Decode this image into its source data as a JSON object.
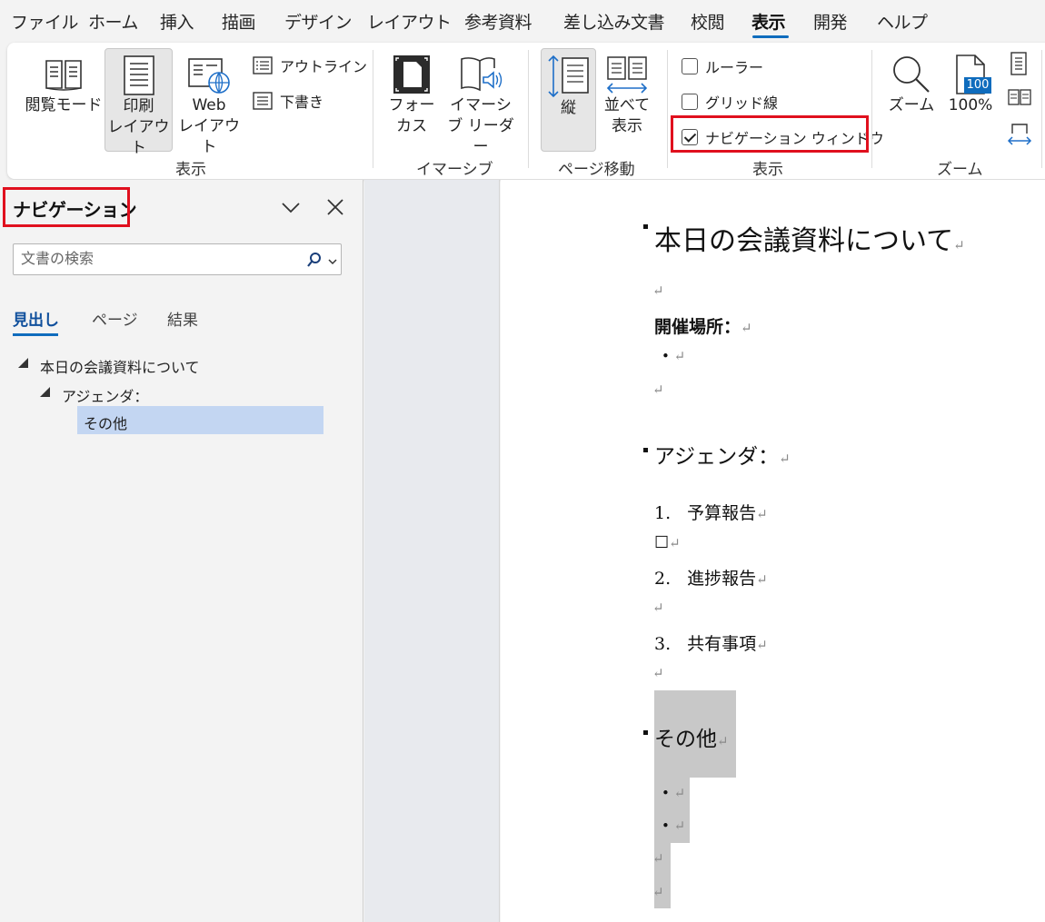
{
  "menubar": {
    "items": [
      {
        "label": "ファイル"
      },
      {
        "label": "ホーム"
      },
      {
        "label": "挿入"
      },
      {
        "label": "描画"
      },
      {
        "label": "デザイン"
      },
      {
        "label": "レイアウト"
      },
      {
        "label": "参考資料"
      },
      {
        "label": "差し込み文書"
      },
      {
        "label": "校閲"
      },
      {
        "label": "表示"
      },
      {
        "label": "開発"
      },
      {
        "label": "ヘルプ"
      }
    ]
  },
  "ribbon": {
    "views_group": {
      "label": "表示",
      "read_mode": "閲覧モード",
      "print_layout_1": "印刷",
      "print_layout_2": "レイアウト",
      "web_layout_1": "Web",
      "web_layout_2": "レイアウト",
      "outline": "アウトライン",
      "draft": "下書き"
    },
    "immersive_group": {
      "label": "イマーシブ",
      "focus_1": "フォー",
      "focus_2": "カス",
      "reader_1": "イマーシ",
      "reader_2": "ブ リーダー"
    },
    "page_move_group": {
      "label": "ページ移動",
      "vertical": "縦",
      "side_1": "並べて",
      "side_2": "表示"
    },
    "show_group": {
      "label": "表示",
      "ruler": "ルーラー",
      "gridlines": "グリッド線",
      "nav_pane": "ナビゲーション ウィンドウ",
      "ruler_checked": false,
      "gridlines_checked": false,
      "nav_pane_checked": true
    },
    "zoom_group": {
      "label": "ズーム",
      "zoom": "ズーム",
      "percent": "100%",
      "icon_badge": "100"
    }
  },
  "nav_pane": {
    "title": "ナビゲーション",
    "search_placeholder": "文書の検索",
    "tabs": [
      {
        "label": "見出し"
      },
      {
        "label": "ページ"
      },
      {
        "label": "結果"
      }
    ],
    "tree": [
      {
        "label": "本日の会議資料について"
      },
      {
        "label": "アジェンダ："
      },
      {
        "label": "その他"
      }
    ]
  },
  "document": {
    "heading1": "本日の会議資料について",
    "venue_label": "開催場所：",
    "agenda_heading": "アジェンダ：",
    "list": [
      {
        "num": "1.",
        "text": "予算報告"
      },
      {
        "num": "2.",
        "text": "進捗報告"
      },
      {
        "num": "3.",
        "text": "共有事項"
      }
    ],
    "box_char": "☐",
    "other_heading": "その他",
    "return_mark": "↵",
    "bullet_char": "•"
  },
  "colors": {
    "accent": "#0f6cbd",
    "highlight_red": "#e0101e",
    "selection": "#c3d6f2",
    "doc_highlight": "#c8c8c8"
  }
}
